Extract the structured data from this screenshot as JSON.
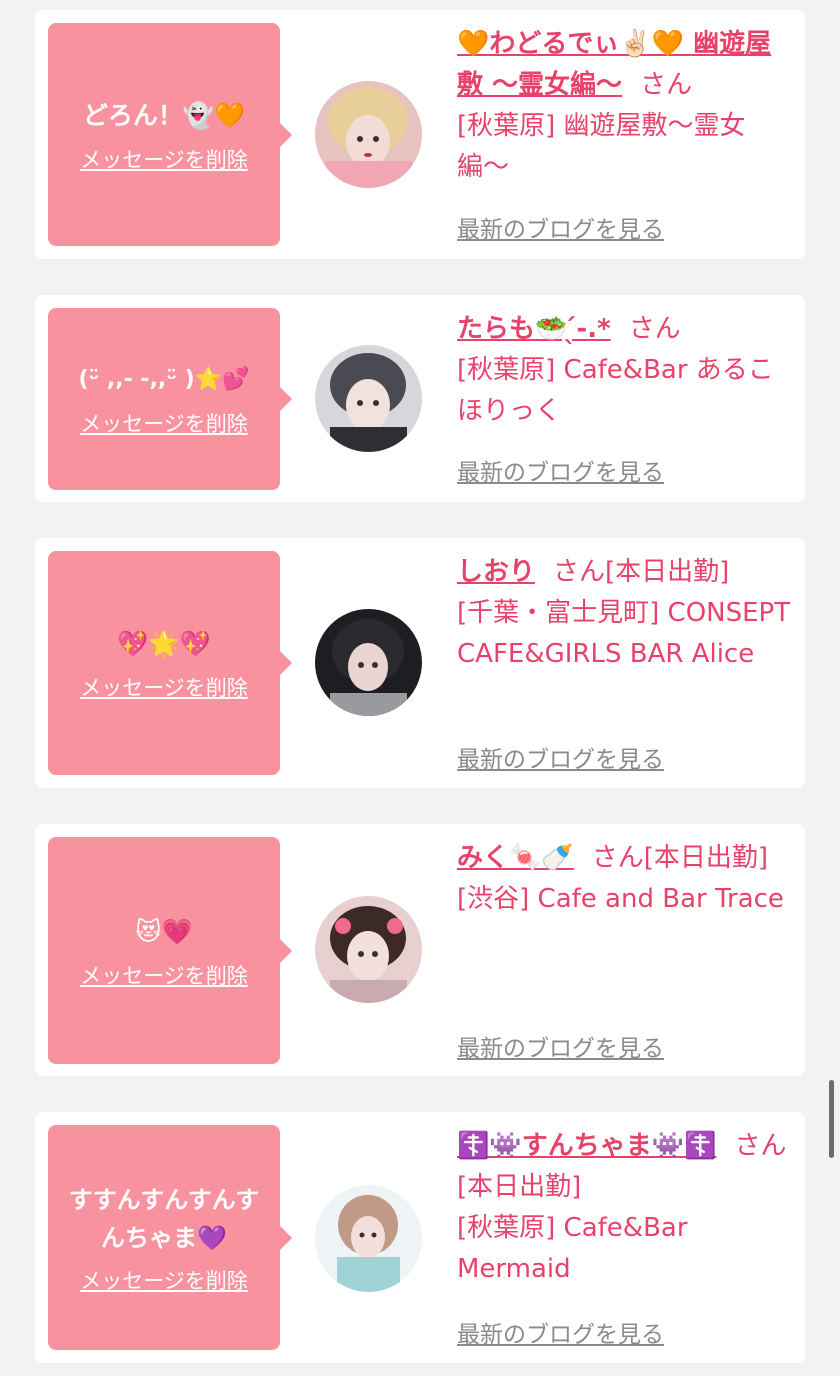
{
  "cards": [
    {
      "message": "どろん！👻🧡",
      "delete_label": "メッセージを削除",
      "name": "🧡わどるでぃ✌🏻🧡 幽遊屋敷 〜霊女編〜",
      "suffix": "さん",
      "shop": "[秋葉原] 幽遊屋敷〜霊女編〜",
      "blog_label": "最新のブログを見る",
      "avatar_color": "#d9a0a8"
    },
    {
      "message": "(ᵕ̈ ,,- -,,ᵕ̈ )⭐💕",
      "delete_label": "メッセージを削除",
      "name": "たらも🥗 ̖́-.*",
      "suffix": "さん",
      "shop": "[秋葉原] Cafe&Bar あるこほりっく",
      "blog_label": "最新のブログを見る",
      "avatar_color": "#8c8f99"
    },
    {
      "message": "💖🌟💖",
      "delete_label": "メッセージを削除",
      "name": "しおり",
      "suffix": "さん[本日出勤]",
      "shop": "[千葉・富士見町] CONSEPT CAFE&GIRLS BAR Alice",
      "blog_label": "最新のブログを見る",
      "avatar_color": "#3a3a3e"
    },
    {
      "message": "😻💗",
      "delete_label": "メッセージを削除",
      "name": "みく🍬🍼",
      "suffix": "さん[本日出勤]",
      "shop": "[渋谷] Cafe and Bar Trace",
      "blog_label": "最新のブログを見る",
      "avatar_color": "#b89088"
    },
    {
      "message": "すすんすんすんすんちゃま💜",
      "delete_label": "メッセージを削除",
      "name": "☦️👾すんちゃま👾☦️",
      "suffix": "さん[本日出勤]",
      "shop": "[秋葉原] Cafe&Bar Mermaid",
      "blog_label": "最新のブログを見る",
      "avatar_color": "#d8e6ea"
    }
  ]
}
